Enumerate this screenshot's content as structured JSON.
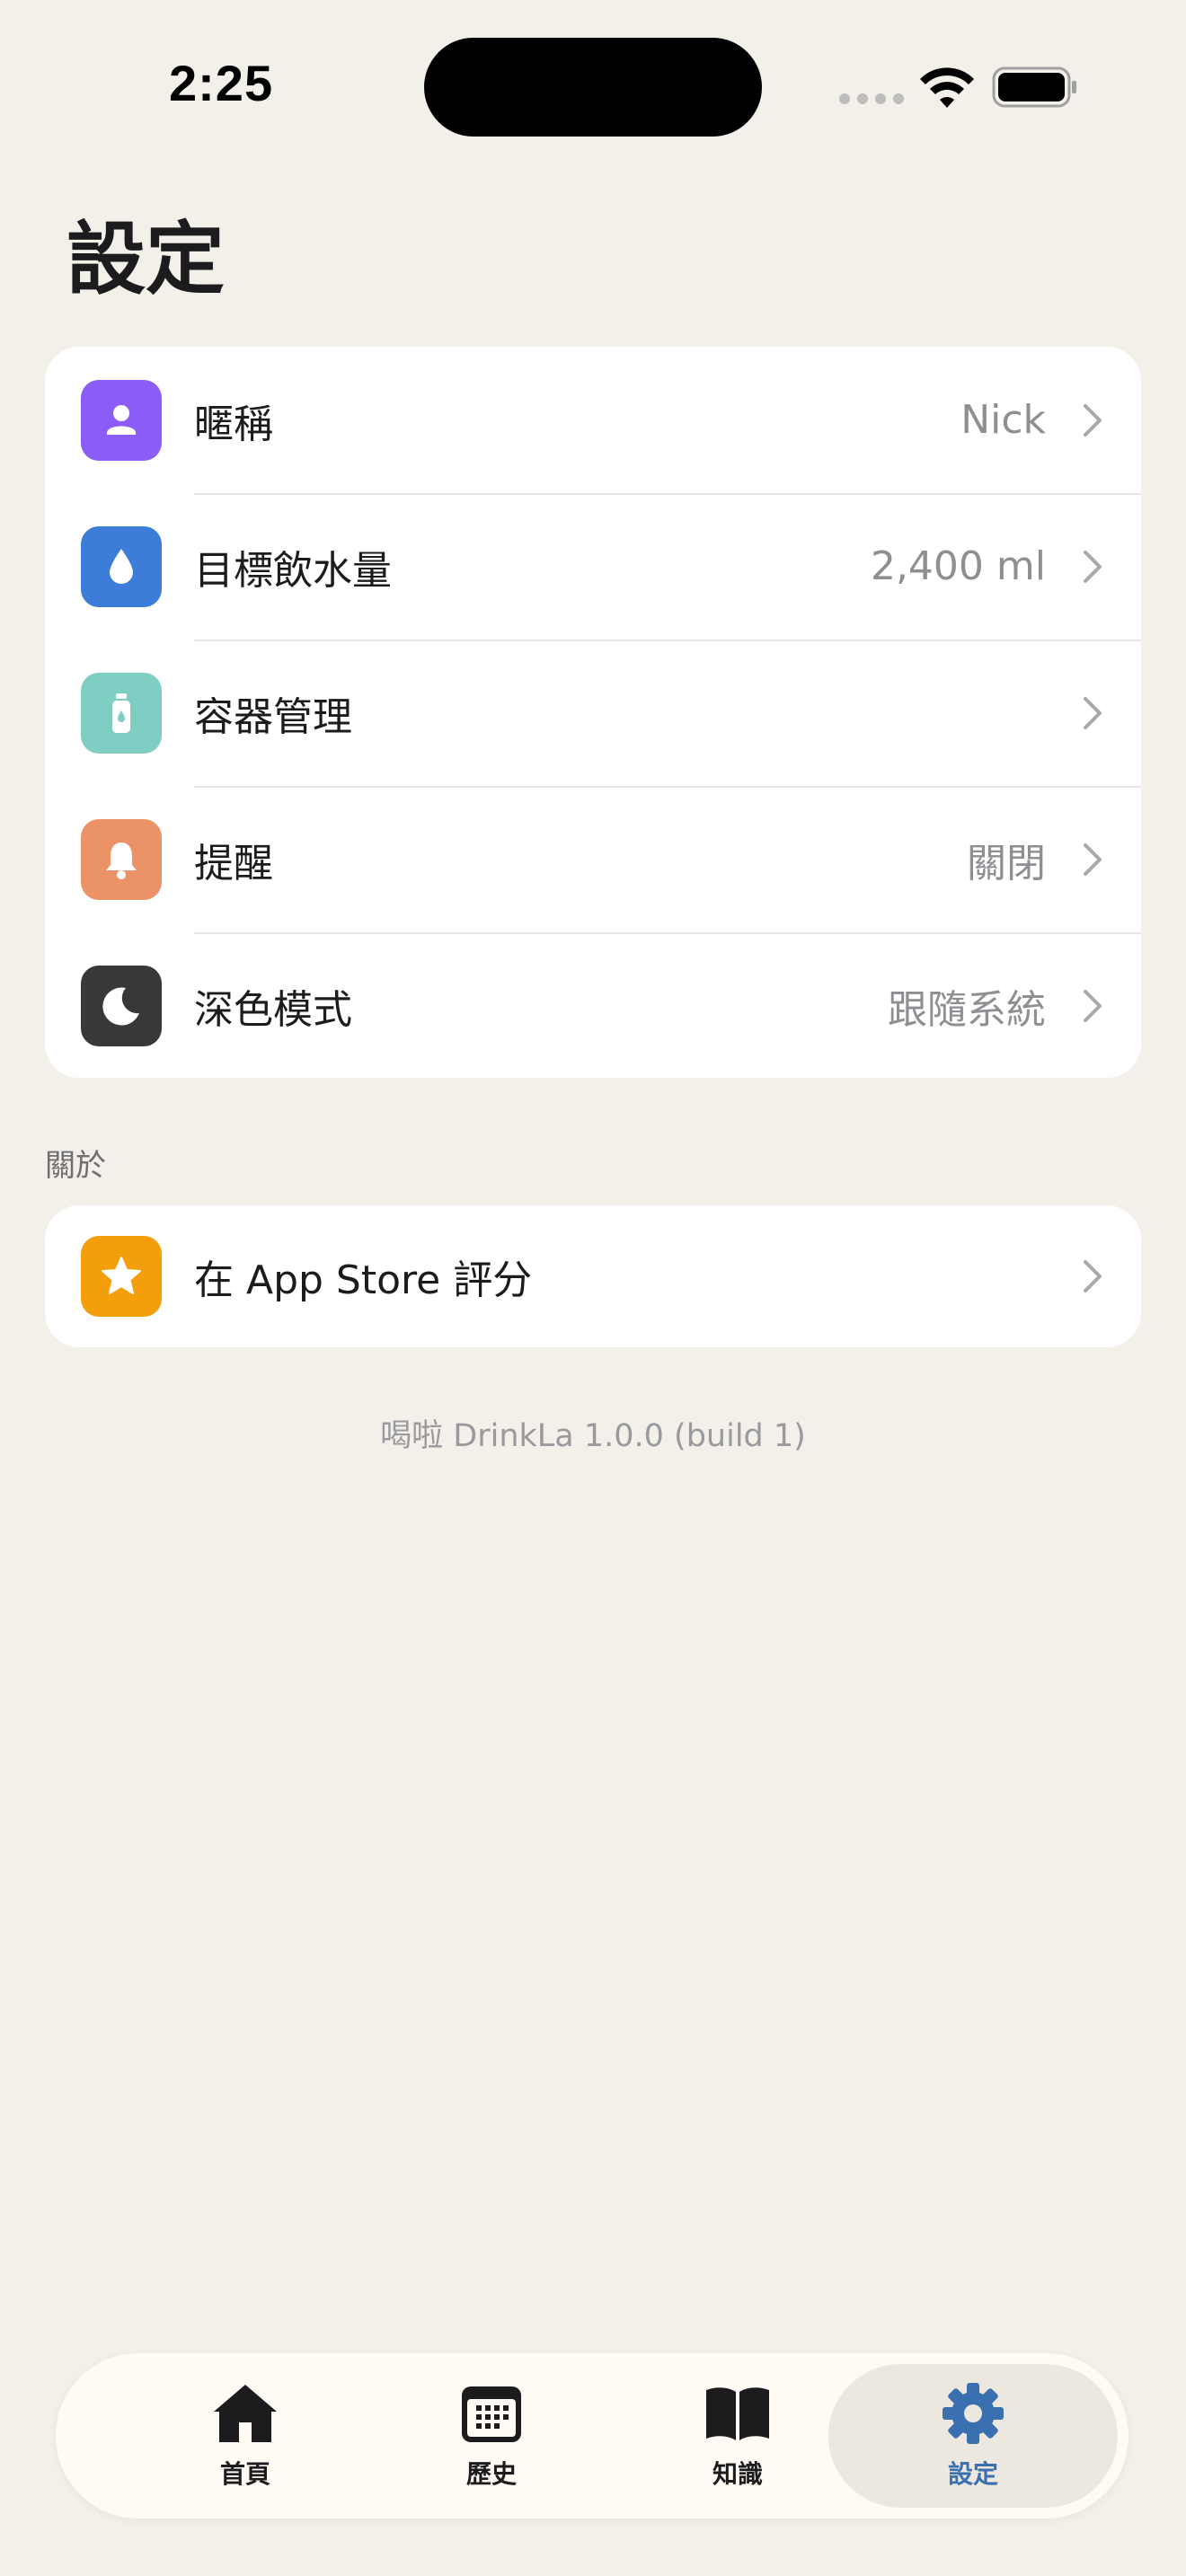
{
  "status_bar": {
    "time": "2:25"
  },
  "page": {
    "title": "設定"
  },
  "settings": {
    "rows": [
      {
        "label": "暱稱",
        "value": "Nick",
        "icon": "person-icon",
        "color": "#8B5CF6"
      },
      {
        "label": "目標飲水量",
        "value": "2,400 ml",
        "icon": "water-drop-icon",
        "color": "#3B7DD8"
      },
      {
        "label": "容器管理",
        "value": "",
        "icon": "bottle-icon",
        "color": "#7ECEC4"
      },
      {
        "label": "提醒",
        "value": "關閉",
        "icon": "bell-icon",
        "color": "#EB9266"
      },
      {
        "label": "深色模式",
        "value": "跟隨系統",
        "icon": "moon-icon",
        "color": "#38383A"
      }
    ]
  },
  "about": {
    "header": "關於",
    "rate_label": "在 App Store 評分",
    "rate_icon": "star-icon",
    "rate_color": "#F59E0B"
  },
  "version": "喝啦 DrinkLa 1.0.0 (build 1)",
  "tab_bar": {
    "tabs": [
      {
        "label": "首頁",
        "icon": "home-icon"
      },
      {
        "label": "歷史",
        "icon": "calendar-icon"
      },
      {
        "label": "知識",
        "icon": "book-icon"
      },
      {
        "label": "設定",
        "icon": "gear-icon",
        "active": true
      }
    ],
    "active_color": "#3A6FB0"
  }
}
